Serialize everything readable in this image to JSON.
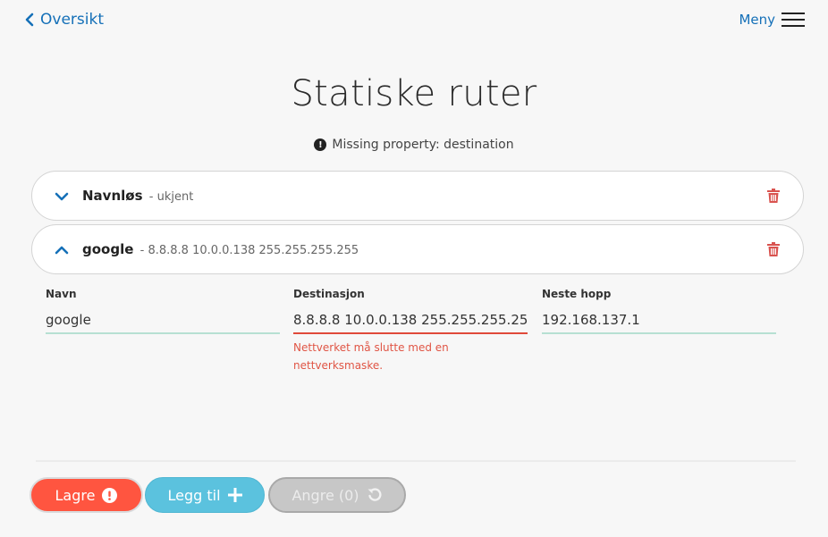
{
  "nav": {
    "back_label": "Oversikt",
    "menu_label": "Meny"
  },
  "page": {
    "title": "Statiske ruter",
    "warning": "Missing property: destination"
  },
  "routes": [
    {
      "name": "Navnløs",
      "detail": "- ukjent",
      "expanded": false
    },
    {
      "name": "google",
      "detail": "- 8.8.8.8 10.0.0.138 255.255.255.255",
      "expanded": true
    }
  ],
  "form": {
    "name": {
      "label": "Navn",
      "value": "google"
    },
    "destination": {
      "label": "Destinasjon",
      "value": "8.8.8.8 10.0.0.138 255.255.255.255",
      "error": "Nettverket må slutte med en nettverksmaske."
    },
    "next_hop": {
      "label": "Neste hopp",
      "value": "192.168.137.1"
    }
  },
  "actions": {
    "save_label": "Lagre",
    "add_label": "Legg til",
    "undo_label": "Angre (0)"
  },
  "colors": {
    "accent": "#1570b8",
    "danger": "#ff5540",
    "add": "#5bc2de",
    "disabled": "#c7c7c7",
    "field_ok": "#b7e0d2",
    "field_error": "#e04a3a"
  }
}
